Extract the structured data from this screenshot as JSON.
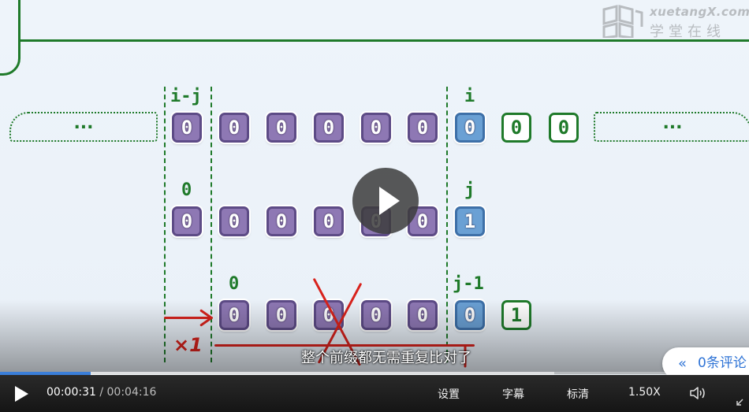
{
  "watermark": {
    "brand_en": "xuetangX.com",
    "brand_cn": "学堂在线"
  },
  "slide": {
    "ellipsis_left": "...",
    "ellipsis_right": "...",
    "row1": {
      "label_left": "i-j",
      "label_right": "i",
      "purple_cells": [
        "0",
        "0",
        "0",
        "0",
        "0",
        "0"
      ],
      "blue_cell": "0",
      "green_cells": [
        "0",
        "0"
      ]
    },
    "row2": {
      "label_left": "0",
      "label_right": "j",
      "purple_cells": [
        "0",
        "0",
        "0",
        "0",
        "0",
        "0"
      ],
      "blue_cell": "1"
    },
    "row3": {
      "label_left": "0",
      "label_right": "j-1",
      "purple_cells": [
        "0",
        "0",
        "0",
        "0",
        "0"
      ],
      "blue_cell": "0",
      "green_cell": "1"
    },
    "annotation": "×1"
  },
  "subtitle": "整个前缀都无需重复比对了",
  "comments": {
    "chevron": "«",
    "label": "0条评论"
  },
  "player": {
    "current_time": "00:00:31",
    "separator": " / ",
    "duration": "00:04:16",
    "progress_fraction": 0.121,
    "buffered_fraction": 0.74,
    "settings_label": "设置",
    "subtitles_label": "字幕",
    "quality_label": "标清",
    "speed_label": "1.50X",
    "accent_color": "#3a7ed9"
  }
}
